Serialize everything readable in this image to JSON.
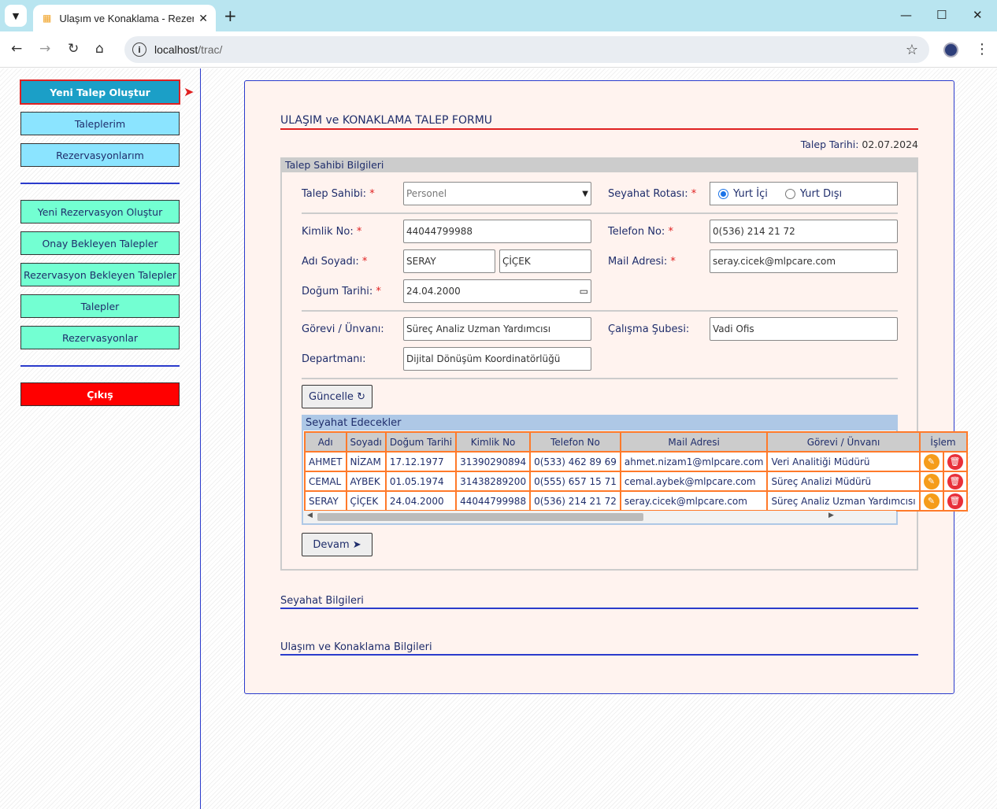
{
  "browser": {
    "tab_title": "Ulaşım ve Konaklama - Rezervasyon",
    "url_host": "localhost",
    "url_path": "/trac/"
  },
  "sidebar": {
    "items": [
      {
        "label": "Yeni Talep Oluştur",
        "style": "active"
      },
      {
        "label": "Taleplerim",
        "style": "blue"
      },
      {
        "label": "Rezervasyonlarım",
        "style": "blue"
      },
      {
        "label": "Yeni Rezervasyon Oluştur",
        "style": "green"
      },
      {
        "label": "Onay Bekleyen Talepler",
        "style": "green"
      },
      {
        "label": "Rezervasyon Bekleyen Talepler",
        "style": "green"
      },
      {
        "label": "Talepler",
        "style": "green"
      },
      {
        "label": "Rezervasyonlar",
        "style": "green"
      },
      {
        "label": "Çıkış",
        "style": "red"
      }
    ]
  },
  "form": {
    "title": "ULAŞIM ve KONAKLAMA TALEP FORMU",
    "date_label": "Talep Tarihi:",
    "date_value": "02.07.2024",
    "section_title": "Talep Sahibi Bilgileri",
    "labels": {
      "talep_sahibi": "Talep Sahibi:",
      "seyahat_rotasi": "Seyahat Rotası:",
      "kimlik_no": "Kimlik No:",
      "telefon_no": "Telefon No:",
      "adi_soyadi": "Adı Soyadı:",
      "mail_adresi": "Mail Adresi:",
      "dogum_tarihi": "Doğum Tarihi:",
      "gorevi": "Görevi / Ünvanı:",
      "calisma_subesi": "Çalışma Şubesi:",
      "departmani": "Departmanı:"
    },
    "required_mark": "*",
    "values": {
      "talep_sahibi": "Personel",
      "kimlik_no": "44044799988",
      "telefon_no": "0(536) 214 21 72",
      "adi": "SERAY",
      "soyadi": "ÇİÇEK",
      "mail_adresi": "seray.cicek@mlpcare.com",
      "dogum_tarihi": "24.04.2000",
      "gorevi": "Süreç Analiz Uzman Yardımcısı",
      "calisma_subesi": "Vadi Ofis",
      "departmani": "Dijital Dönüşüm Koordinatörlüğü"
    },
    "route_options": [
      {
        "label": "Yurt İçi",
        "checked": true
      },
      {
        "label": "Yurt Dışı",
        "checked": false
      }
    ],
    "update_button": "Güncelle ↻",
    "continue_button": "Devam ➤"
  },
  "travelers": {
    "title": "Seyahat Edecekler",
    "columns": [
      "Adı",
      "Soyadı",
      "Doğum Tarihi",
      "Kimlik No",
      "Telefon No",
      "Mail Adresi",
      "Görevi / Ünvanı",
      "İşlem"
    ],
    "rows": [
      [
        "AHMET",
        "NİZAM",
        "17.12.1977",
        "31390290894",
        "0(533) 462 89 69",
        "ahmet.nizam1@mlpcare.com",
        "Veri Analitiği Müdürü"
      ],
      [
        "CEMAL",
        "AYBEK",
        "01.05.1974",
        "31438289200",
        "0(555) 657 15 71",
        "cemal.aybek@mlpcare.com",
        "Süreç Analizi Müdürü"
      ],
      [
        "SERAY",
        "ÇİÇEK",
        "24.04.2000",
        "44044799988",
        "0(536) 214 21 72",
        "seray.cicek@mlpcare.com",
        "Süreç Analiz Uzman Yardımcısı"
      ]
    ]
  },
  "sections": {
    "seyahat": "Seyahat Bilgileri",
    "ulasim": "Ulaşım ve Konaklama Bilgileri"
  },
  "colors": {
    "accent_line": "#e02020",
    "section_line": "#2b3bcc",
    "table_border": "#ff7a2a"
  }
}
